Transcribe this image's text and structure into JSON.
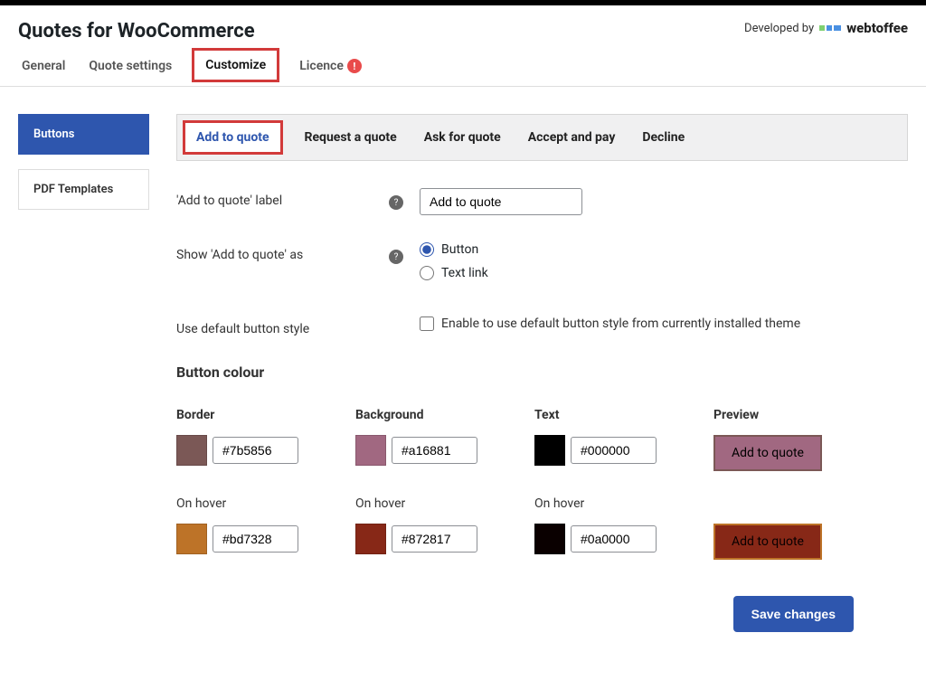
{
  "header": {
    "title": "Quotes for WooCommerce",
    "developed_by": "Developed by",
    "brand": "webtoffee"
  },
  "main_tabs": {
    "general": "General",
    "quote_settings": "Quote settings",
    "customize": "Customize",
    "licence": "Licence",
    "licence_warn": "!"
  },
  "sidebar": {
    "buttons": "Buttons",
    "pdf_templates": "PDF Templates"
  },
  "sub_tabs": {
    "add_to_quote": "Add to quote",
    "request_a_quote": "Request a quote",
    "ask_for_quote": "Ask for quote",
    "accept_and_pay": "Accept and pay",
    "decline": "Decline"
  },
  "form": {
    "label_field": "'Add to quote' label",
    "label_value": "Add to quote",
    "show_as_label": "Show 'Add to quote' as",
    "show_as_button": "Button",
    "show_as_text_link": "Text link",
    "use_default_label": "Use default button style",
    "use_default_desc": "Enable to use default button style from currently installed theme"
  },
  "button_colour": {
    "title": "Button colour",
    "border_label": "Border",
    "background_label": "Background",
    "text_label": "Text",
    "preview_label": "Preview",
    "on_hover_label": "On hover",
    "border": "#7b5856",
    "background": "#a16881",
    "text": "#000000",
    "border_hover": "#bd7328",
    "background_hover": "#872817",
    "text_hover": "#0a0000",
    "preview_text": "Add to quote"
  },
  "actions": {
    "save": "Save changes"
  }
}
